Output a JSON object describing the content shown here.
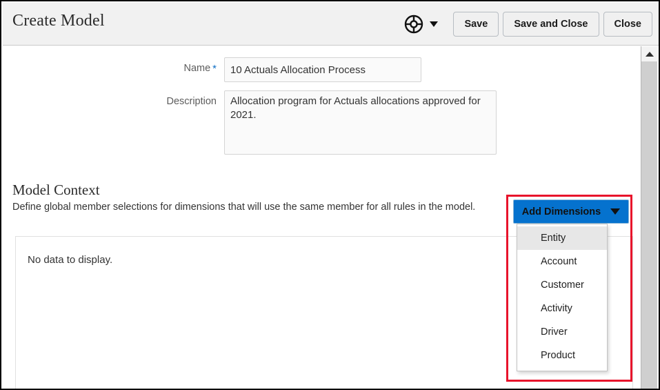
{
  "header": {
    "title": "Create Model",
    "wheel_icon": "lifesaver-wheel-icon",
    "wheel_caret_icon": "chevron-down-icon",
    "buttons": [
      {
        "label": "Save",
        "name": "save-button"
      },
      {
        "label": "Save and Close",
        "name": "save-and-close-button"
      },
      {
        "label": "Close",
        "name": "close-button"
      }
    ]
  },
  "form": {
    "name": {
      "label": "Name",
      "required_marker": "*",
      "value": "10 Actuals Allocation Process",
      "placeholder": ""
    },
    "description": {
      "label": "Description",
      "value": "Allocation program for Actuals allocations approved for 2021.",
      "placeholder": ""
    }
  },
  "model_context": {
    "heading": "Model Context",
    "description": "Define global member selections for dimensions that will use the same member for all rules in the model.",
    "empty_message": "No data to display."
  },
  "add_dimensions": {
    "button_label": "Add Dimensions",
    "caret_icon": "caret-down-icon",
    "menu_items": [
      {
        "label": "Entity",
        "selected": true
      },
      {
        "label": "Account",
        "selected": false
      },
      {
        "label": "Customer",
        "selected": false
      },
      {
        "label": "Activity",
        "selected": false
      },
      {
        "label": "Driver",
        "selected": false
      },
      {
        "label": "Product",
        "selected": false
      }
    ]
  },
  "scrollbar": {
    "up_arrow_icon": "chevron-up-icon"
  },
  "colors": {
    "accent_blue": "#0572ce",
    "required_star": "#0f6fc5",
    "annotation_red": "#e8132b",
    "header_bg": "#f1f1f1",
    "menu_hover": "#e7e7e7"
  }
}
